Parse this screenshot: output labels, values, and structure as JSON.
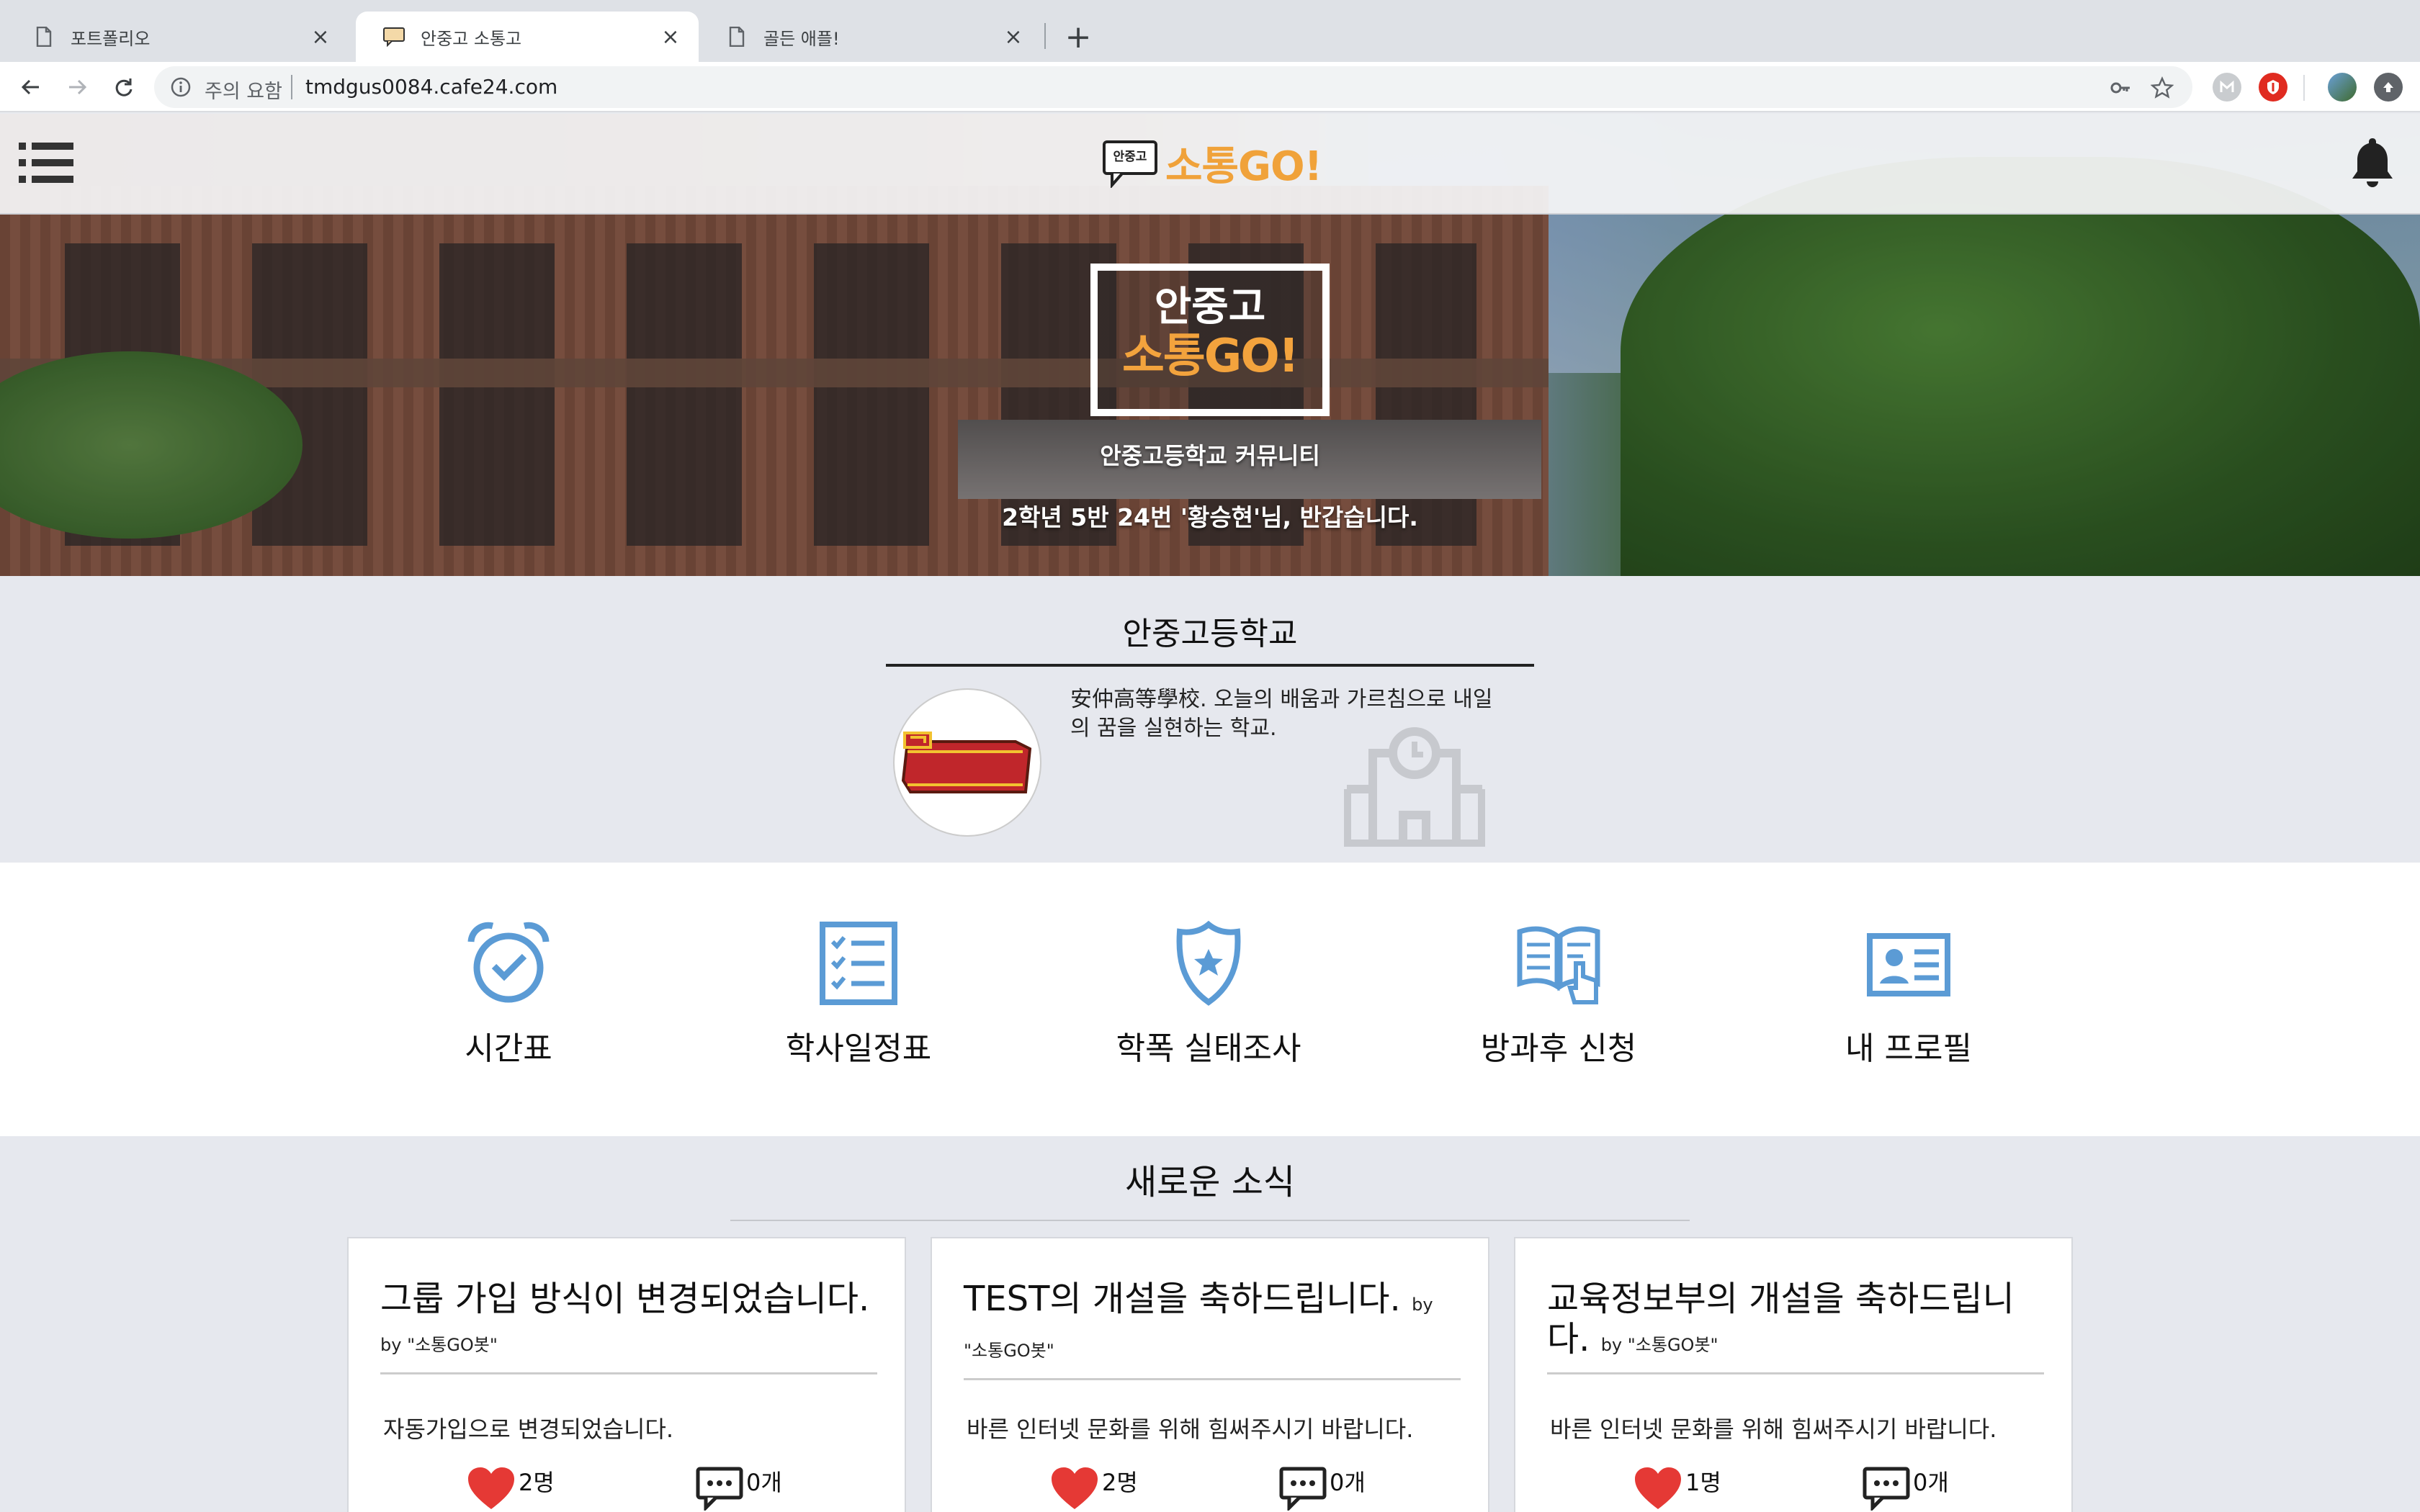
{
  "browser": {
    "tabs": [
      {
        "title": "포트폴리오",
        "icon": "document-icon"
      },
      {
        "title": "안중고 소통고",
        "icon": "site-favicon"
      },
      {
        "title": "골든 애플!",
        "icon": "document-icon"
      }
    ],
    "omnibox": {
      "security_label": "주의 요함",
      "url": "tmdgus0084.cafe24.com"
    }
  },
  "site": {
    "brand": {
      "bubble_text": "안중고",
      "name": "소통GO!"
    },
    "hero": {
      "box_line1": "안중고",
      "box_line2": "소통GO!",
      "subtitle": "안중고등학교 커뮤니티",
      "greeting": "2학년 5반 24번 '황승현'님, 반갑습니다."
    },
    "intro": {
      "title": "안중고등학교",
      "logo_text": "안녕자0",
      "description": "安仲高等學校. 오늘의 배움과 가르침으로 내일의 꿈을 실현하는 학교."
    },
    "quick_links": [
      {
        "label": "시간표",
        "icon": "alarm-clock-icon"
      },
      {
        "label": "학사일정표",
        "icon": "checklist-icon"
      },
      {
        "label": "학폭 실태조사",
        "icon": "police-badge-icon"
      },
      {
        "label": "방과후 신청",
        "icon": "book-touch-icon"
      },
      {
        "label": "내 프로필",
        "icon": "id-card-icon"
      }
    ],
    "news": {
      "title": "새로운 소식",
      "cards": [
        {
          "title": "그룹 가입 방식이 변경되었습니다.",
          "by": "by \"소통GO봇\"",
          "body": "자동가입으로 변경되었습니다.",
          "likes": "2명",
          "comments": "0개"
        },
        {
          "title": "TEST의 개설을 축하드립니다.",
          "by": "by \"소통GO봇\"",
          "body": "바른 인터넷 문화를 위해 힘써주시기 바랍니다.",
          "likes": "2명",
          "comments": "0개"
        },
        {
          "title": "교육정보부의 개설을 축하드립니다.",
          "by": "by \"소통GO봇\"",
          "body": "바른 인터넷 문화를 위해 힘써주시기 바랍니다.",
          "likes": "1명",
          "comments": "0개"
        }
      ]
    }
  },
  "colors": {
    "brand_orange": "#f0a23a",
    "quick_icon_blue": "#5b9bd5",
    "heart_red": "#e53935"
  }
}
